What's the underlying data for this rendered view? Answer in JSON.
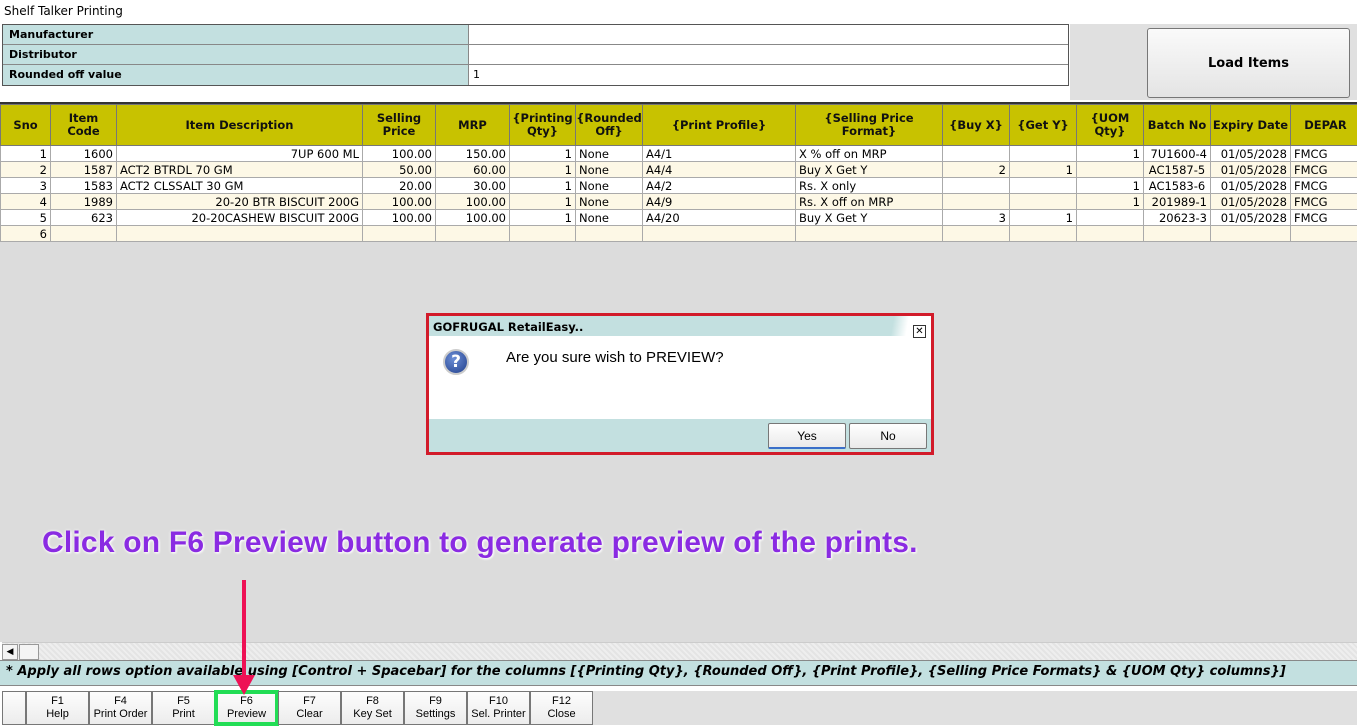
{
  "window_title": "Shelf Talker Printing",
  "form": {
    "manufacturer_label": "Manufacturer",
    "manufacturer_value": "",
    "distributor_label": "Distributor",
    "distributor_value": "",
    "rounded_label": "Rounded off value",
    "rounded_value": "1"
  },
  "load_items_label": "Load Items",
  "table": {
    "columns": [
      "Sno",
      "Item Code",
      "Item Description",
      "Selling Price",
      "MRP",
      "{Printing Qty}",
      "{Rounded Off}",
      "{Print Profile}",
      "{Selling Price Format}",
      "{Buy X}",
      "{Get Y}",
      "{UOM Qty}",
      "Batch No",
      "Expiry Date",
      "DEPAR"
    ],
    "rows": [
      [
        "1",
        "1600",
        "7UP 600 ML",
        "100.00",
        "150.00",
        "1",
        "None",
        "A4/1",
        "X % off on MRP",
        "",
        "",
        "1",
        "7U1600-4",
        "01/05/2028",
        "FMCG"
      ],
      [
        "2",
        "1587",
        "ACT2 BTRDL 70 GM",
        "50.00",
        "60.00",
        "1",
        "None",
        "A4/4",
        "Buy X Get Y",
        "2",
        "1",
        "",
        "AC1587-5",
        "01/05/2028",
        "FMCG"
      ],
      [
        "3",
        "1583",
        "ACT2 CLSSALT 30 GM",
        "20.00",
        "30.00",
        "1",
        "None",
        "A4/2",
        "Rs. X only",
        "",
        "",
        "1",
        "AC1583-6",
        "01/05/2028",
        "FMCG"
      ],
      [
        "4",
        "1989",
        "20-20 BTR BISCUIT 200G",
        "100.00",
        "100.00",
        "1",
        "None",
        "A4/9",
        "Rs. X off on MRP",
        "",
        "",
        "1",
        "201989-1",
        "01/05/2028",
        "FMCG"
      ],
      [
        "5",
        "623",
        "20-20CASHEW BISCUIT 200G",
        "100.00",
        "100.00",
        "1",
        "None",
        "A4/20",
        "Buy X Get Y",
        "3",
        "1",
        "",
        "20623-3",
        "01/05/2028",
        "FMCG"
      ],
      [
        "6",
        "",
        "",
        "",
        "",
        "",
        "",
        "",
        "",
        "",
        "",
        "",
        "",
        "",
        ""
      ]
    ]
  },
  "note": "* Apply all rows option available using [Control + Spacebar] for the columns [{Printing Qty}, {Rounded Off}, {Print Profile}, {Selling Price Formats} & {UOM Qty} columns}]",
  "fkeys": [
    {
      "key": "F1",
      "label": "Help"
    },
    {
      "key": "F4",
      "label": "Print Order"
    },
    {
      "key": "F5",
      "label": "Print"
    },
    {
      "key": "F6",
      "label": "Preview"
    },
    {
      "key": "F7",
      "label": "Clear"
    },
    {
      "key": "F8",
      "label": "Key Set"
    },
    {
      "key": "F9",
      "label": "Settings"
    },
    {
      "key": "F10",
      "label": "Sel. Printer"
    },
    {
      "key": "F12",
      "label": "Close"
    }
  ],
  "dialog": {
    "title": "GOFRUGAL RetailEasy..",
    "message": "Are you sure wish to PREVIEW?",
    "yes": "Yes",
    "no": "No",
    "close": "✕",
    "icon": "?"
  },
  "caption": "Click on F6 Preview button to generate preview of the prints.",
  "colors": {
    "header": "#c8c200",
    "panel": "#c3e0e0",
    "dialog_border": "#d21b2a",
    "highlight": "#22dd55",
    "caption": "#8a2be2"
  }
}
